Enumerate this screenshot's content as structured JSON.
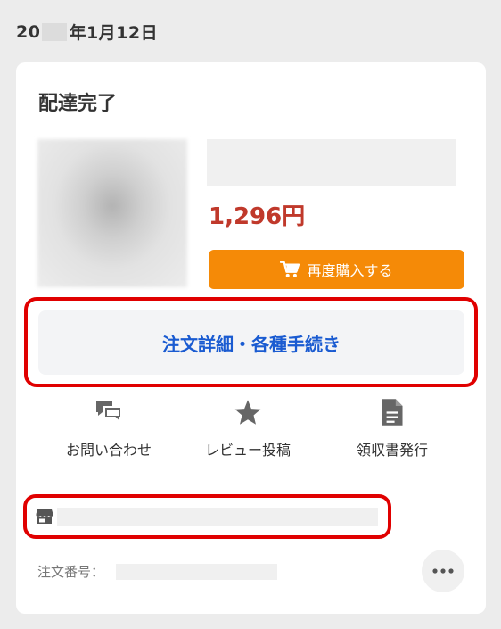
{
  "order_date": {
    "prefix": "20",
    "suffix": "年1月12日"
  },
  "card": {
    "status": "配達完了",
    "price": "1,296円",
    "rebuy_label": "再度購入する",
    "order_details_label": "注文詳細・各種手続き",
    "actions": [
      {
        "icon": "chat-bubbles-icon",
        "label": "お問い合わせ"
      },
      {
        "icon": "star-icon",
        "label": "レビュー投稿"
      },
      {
        "icon": "document-icon",
        "label": "領収書発行"
      }
    ],
    "shop_icon": "store-icon",
    "order_number_label": "注文番号：",
    "more_icon": "more-dots-icon"
  },
  "colors": {
    "background": "#ececec",
    "price": "#c0392b",
    "rebuy_button": "#f58a07",
    "link_blue": "#1a5bd1",
    "highlight_red": "#e00000",
    "icon_gray": "#666666"
  }
}
